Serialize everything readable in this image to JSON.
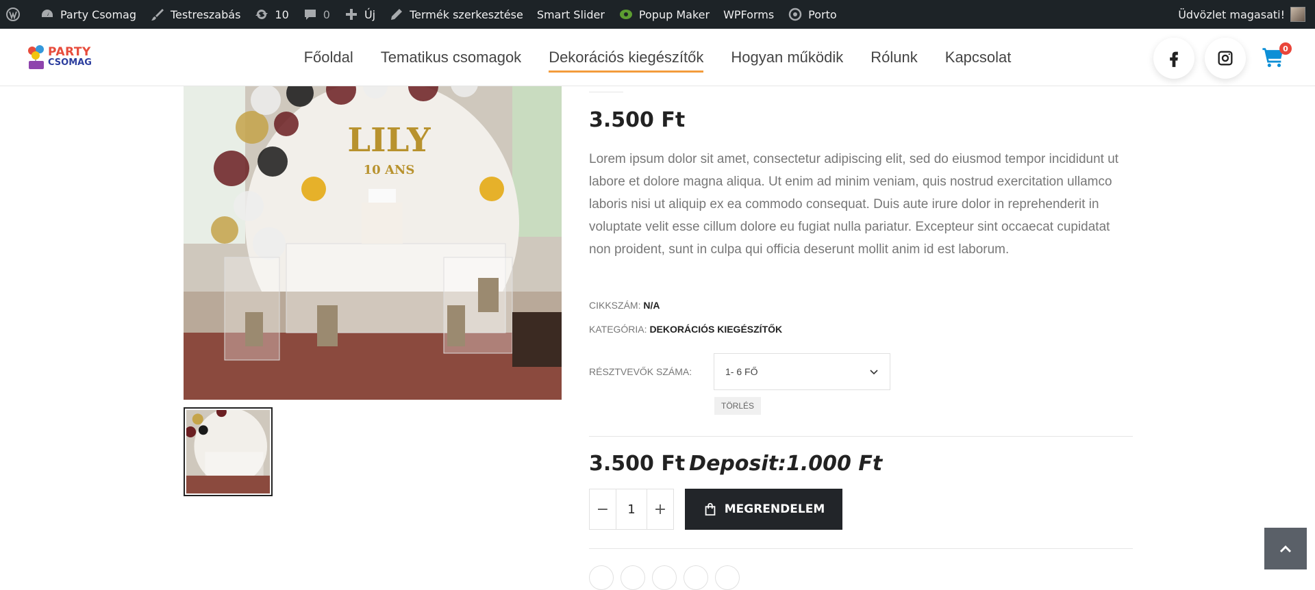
{
  "adminbar": {
    "site_name": "Party Csomag",
    "customize": "Testreszabás",
    "updates_count": "10",
    "comments_count": "0",
    "new_label": "Új",
    "edit_product": "Termék szerkesztése",
    "smart_slider": "Smart Slider",
    "popup_maker": "Popup Maker",
    "wpforms": "WPForms",
    "porto": "Porto",
    "greeting": "Üdvözlet magasati!"
  },
  "header": {
    "logo_top": "PARTY",
    "logo_bottom": "CSOMAG",
    "nav": [
      {
        "label": "Főoldal"
      },
      {
        "label": "Tematikus csomagok"
      },
      {
        "label": "Dekorációs kiegészítők"
      },
      {
        "label": "Hogyan működik"
      },
      {
        "label": "Rólunk"
      },
      {
        "label": "Kapcsolat"
      }
    ],
    "cart_count": "0"
  },
  "product": {
    "image_text_top": "LILY",
    "image_text_bottom": "10 ANS",
    "price": "3.500 Ft",
    "description": "Lorem ipsum dolor sit amet, consectetur adipiscing elit, sed do eiusmod tempor incididunt ut labore et dolore magna aliqua. Ut enim ad minim veniam, quis nostrud exercitation ullamco laboris nisi ut aliquip ex ea commodo consequat. Duis aute irure dolor in reprehenderit in voluptate velit esse cillum dolore eu fugiat nulla pariatur. Excepteur sint occaecat cupidatat non proident, sunt in culpa qui officia deserunt mollit anim id est laborum.",
    "sku_label": "CIKKSZÁM:",
    "sku_value": "N/A",
    "category_label": "KATEGÓRIA:",
    "category_value": "DEKORÁCIÓS KIEGÉSZÍTŐK",
    "attr_label": "RÉSZTVEVŐK SZÁMA:",
    "attr_value": "1- 6 FŐ",
    "reset_label": "TÖRLÉS",
    "final_price": "3.500 Ft",
    "deposit": "Deposit:1.000 Ft",
    "quantity": "1",
    "order_button": "MEGRENDELEM",
    "accent_color": "#f39c3b",
    "button_color": "#222529"
  }
}
